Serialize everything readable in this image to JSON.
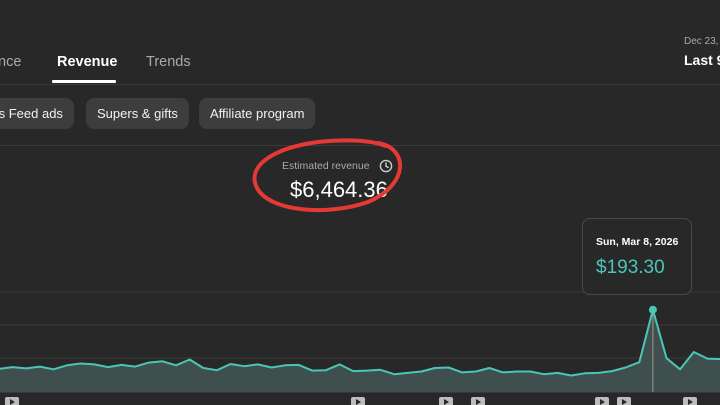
{
  "tabs": [
    {
      "label": "nce",
      "active": false
    },
    {
      "label": "Revenue",
      "active": true
    },
    {
      "label": "Trends",
      "active": false
    }
  ],
  "date_range": {
    "label": "Dec 23,",
    "value": "Last 9"
  },
  "chips": [
    {
      "label": "ts Feed ads"
    },
    {
      "label": "Supers & gifts"
    },
    {
      "label": "Affiliate program"
    }
  ],
  "metric": {
    "label": "Estimated revenue",
    "value": "$6,464.36",
    "icon": "clock-icon"
  },
  "tooltip": {
    "date": "Sun, Mar 8, 2026",
    "value": "$193.30"
  },
  "colors": {
    "background": "#282828",
    "accent": "#4cc5b9",
    "annotation": "#e53935"
  },
  "chart_data": {
    "type": "area",
    "series": [
      {
        "values": [
          52,
          56,
          53,
          57,
          51,
          60,
          64,
          62,
          56,
          61,
          57,
          66,
          69,
          60,
          73,
          54,
          49,
          63,
          58,
          62,
          55,
          60,
          61,
          48,
          49,
          62,
          47,
          48,
          50,
          40,
          43,
          46,
          54,
          55,
          44,
          46,
          54,
          44,
          46,
          46,
          40,
          43,
          37,
          42,
          43,
          47,
          55,
          67,
          185,
          76,
          51,
          90,
          75,
          74
        ]
      }
    ],
    "highlight_index": 48,
    "highlight_value": 193.3
  }
}
